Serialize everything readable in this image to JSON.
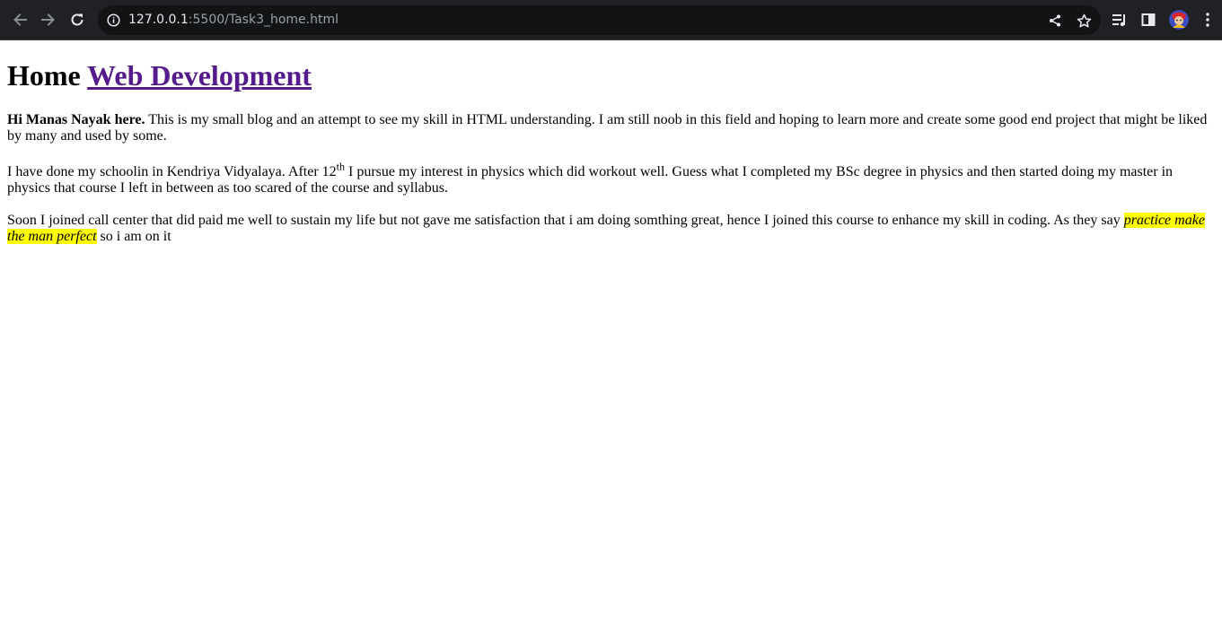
{
  "browser": {
    "url_host": "127.0.0.1",
    "url_rest": ":5500/Task3_home.html"
  },
  "heading": {
    "text": "Home",
    "link_text": "Web Development"
  },
  "para1": {
    "bold": "Hi Manas Nayak here.",
    "text": " This is my small blog and an attempt to see my skill in HTML understanding. I am still noob in this field and hoping to learn more and create some good end project that might be liked by many and used by some."
  },
  "para2": {
    "text_before": "I have done my schoolin in Kendriya Vidyalaya. After 12",
    "sup": "th",
    "text_after": " I pursue my interest in physics which did workout well. Guess what I completed my BSc degree in physics and then started doing my master in physics that course I left in between as too scared of the course and syllabus."
  },
  "para3": {
    "text_before": "Soon I joined call center that did paid me well to sustain my life but not gave me satisfaction that i am doing somthing great, hence I joined this course to enhance my skill in coding. As they say ",
    "highlight": "practice make the man perfect",
    "text_after": " so i am on it"
  },
  "icons": {
    "back": "arrow-left-icon",
    "forward": "arrow-right-icon",
    "reload": "reload-icon",
    "info": "info-icon",
    "share": "share-icon",
    "bookmark": "star-icon",
    "reading_list": "reading-list-icon",
    "side_panel": "side-panel-icon",
    "menu": "kebab-menu-icon"
  },
  "colors": {
    "toolbar_bg": "#202124",
    "omnibox_bg": "#121315",
    "link_visited": "#551a8b",
    "highlight": "#ffff00"
  }
}
